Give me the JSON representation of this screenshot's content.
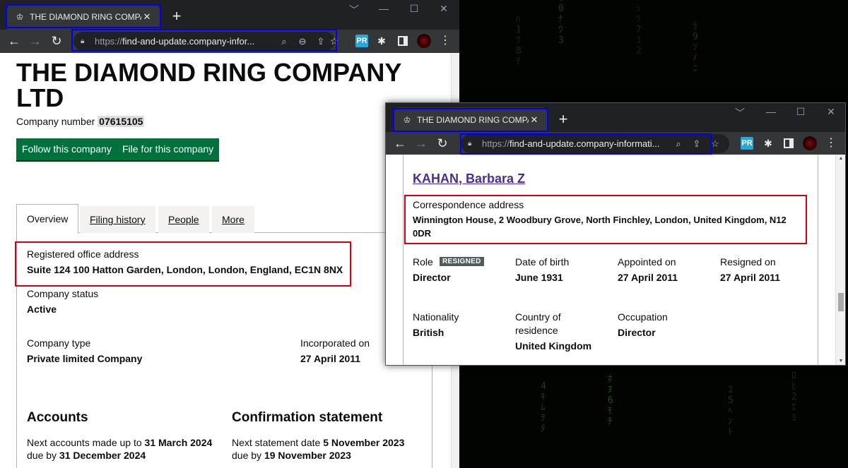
{
  "background": {
    "matrix_glyphs": [
      "ﾊ1ｳ8ﾃ",
      "ﾐ0ﾅﾜ3",
      "ｼﾂ7ﾕ2",
      "ﾗ9ｿﾒﾆ",
      "4ｷﾑｦﾀ",
      "ﾎﾇ6ﾓﾁ",
      "ｺ5ﾍﾝﾄ",
      "ﾛﾋ2ｴﾖ"
    ]
  },
  "window1": {
    "tab": {
      "title": "THE DIAMOND RING COMPANY",
      "favicon": "crown-icon",
      "close": "✕"
    },
    "new_tab": "+",
    "controls": {
      "minimize": "﹀",
      "min": "—",
      "max": "☐",
      "close": "✕"
    },
    "address": {
      "scheme": "https://",
      "url": "find-and-update.company-infor..."
    },
    "page": {
      "title": "THE DIAMOND RING COMPANY LTD",
      "company_number_label": "Company number",
      "company_number": "07615105",
      "buttons": {
        "follow": "Follow this company",
        "file": "File for this company"
      },
      "tabs": [
        "Overview",
        "Filing history",
        "People",
        "More"
      ],
      "registered_office_label": "Registered office address",
      "registered_office": "Suite 124 100 Hatton Garden, London, London, England, EC1N 8NX",
      "status_label": "Company status",
      "status": "Active",
      "type_label": "Company type",
      "type": "Private limited Company",
      "incorporated_label": "Incorporated on",
      "incorporated": "27 April 2011",
      "accounts_heading": "Accounts",
      "accounts_next_label": "Next accounts made up to",
      "accounts_next": "31 March 2024",
      "accounts_due_label": "due by",
      "accounts_due": "31 December 2024",
      "confirmation_heading": "Confirmation statement",
      "confirmation_next_label": "Next statement date",
      "confirmation_next": "5 November 2023",
      "confirmation_due_label": "due by",
      "confirmation_due": "19 November 2023"
    }
  },
  "window2": {
    "tab": {
      "title": "THE DIAMOND RING COMPANY",
      "favicon": "crown-icon",
      "close": "✕"
    },
    "new_tab": "+",
    "controls": {
      "minimize": "﹀",
      "min": "—",
      "max": "☐",
      "close": "✕"
    },
    "address": {
      "scheme": "https://",
      "url": "find-and-update.company-informati..."
    },
    "page": {
      "officer_name": "KAHAN, Barbara Z",
      "correspondence_label": "Correspondence address",
      "correspondence_line1": "Winnington House, 2 Woodbury Grove, North Finchley, London, United Kingdom, N12",
      "correspondence_line2": "0DR",
      "role_label": "Role",
      "resigned_badge": "RESIGNED",
      "role": "Director",
      "dob_label": "Date of birth",
      "dob": "June 1931",
      "appointed_label": "Appointed on",
      "appointed": "27 April 2011",
      "resigned_label": "Resigned on",
      "resigned": "27 April 2011",
      "nationality_label": "Nationality",
      "nationality": "British",
      "country_label_1": "Country of",
      "country_label_2": "residence",
      "country": "United Kingdom",
      "occupation_label": "Occupation",
      "occupation": "Director"
    }
  },
  "colors": {
    "chrome_dark": "#202124",
    "chrome_toolbar": "#35363a",
    "govuk_green": "#00703c",
    "link_purple": "#4c2c92",
    "highlight_blue": "#0000ee",
    "highlight_red": "#d4000f"
  }
}
